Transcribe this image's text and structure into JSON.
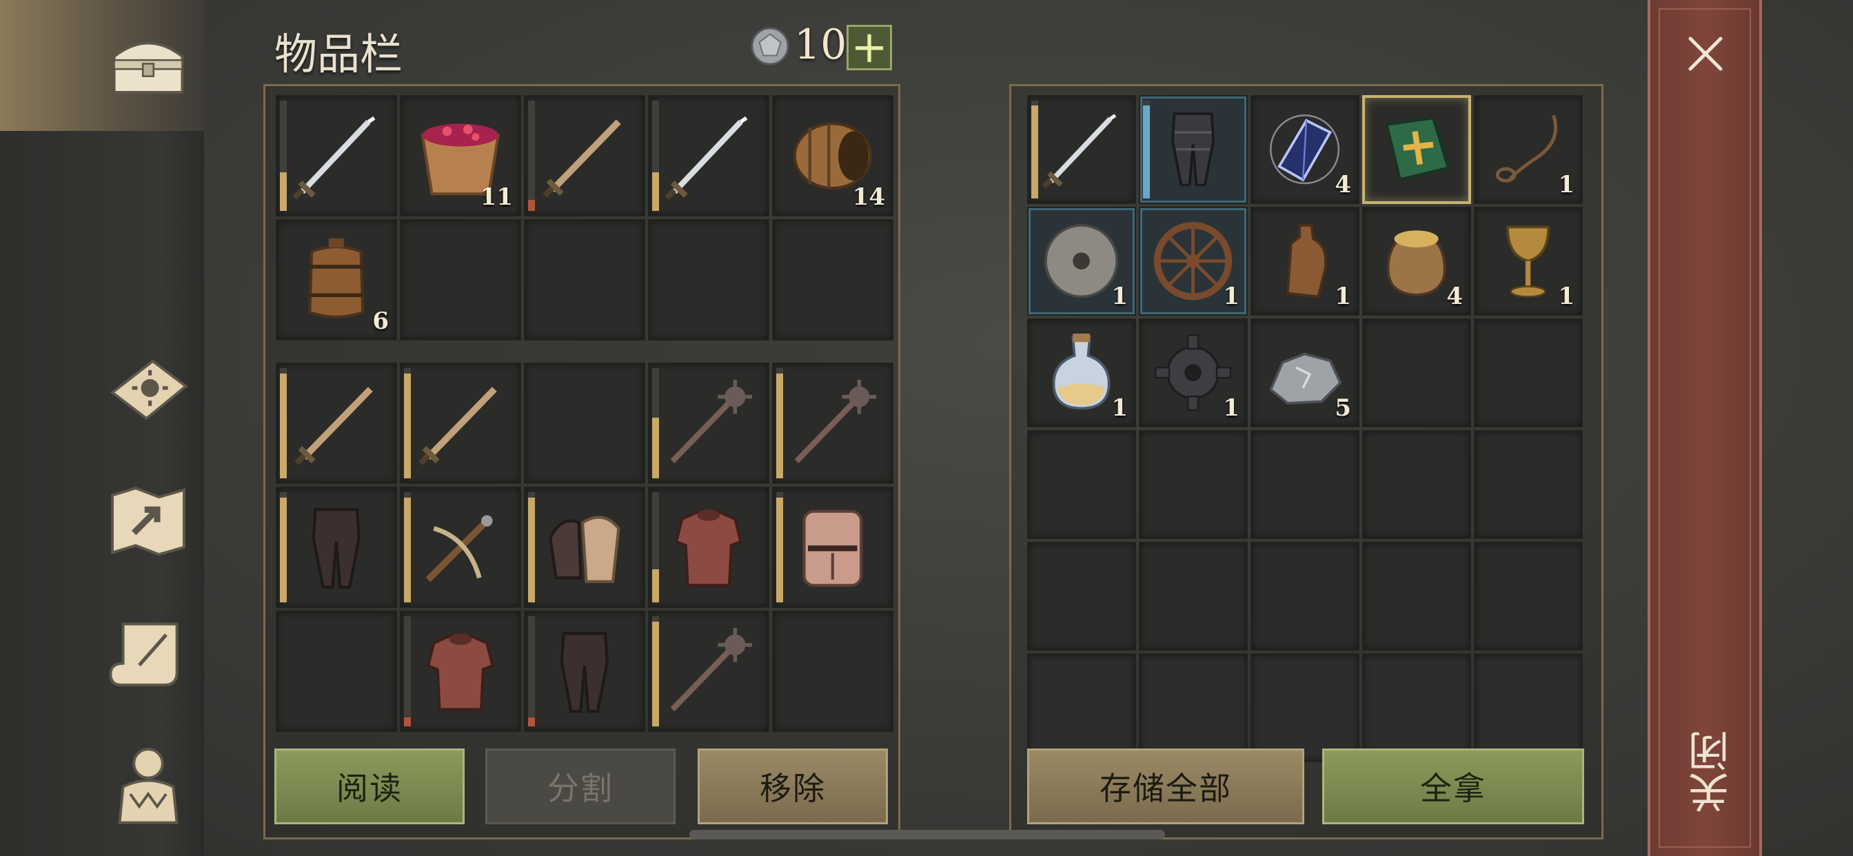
{
  "inventory": {
    "title": "物品栏",
    "currency": "10",
    "plus": "+",
    "top_slots": [
      {
        "icon": "sword-icon",
        "qty": "",
        "durability": 0.35,
        "dur_color": "tan"
      },
      {
        "icon": "berry-bucket-icon",
        "qty": "11"
      },
      {
        "icon": "wooden-sword-icon",
        "qty": "",
        "durability": 0.1,
        "dur_color": "red"
      },
      {
        "icon": "sword-icon",
        "qty": "",
        "durability": 0.35,
        "dur_color": "tan"
      },
      {
        "icon": "barrel-icon",
        "qty": "14"
      },
      {
        "icon": "wine-barrel-icon",
        "qty": "6"
      },
      {
        "icon": "",
        "qty": ""
      },
      {
        "icon": "",
        "qty": ""
      },
      {
        "icon": "",
        "qty": ""
      },
      {
        "icon": "",
        "qty": ""
      }
    ],
    "gear_slots": [
      {
        "icon": "wooden-sword-icon",
        "durability": 0.95,
        "dur_color": "tan"
      },
      {
        "icon": "wooden-sword-icon",
        "durability": 0.95,
        "dur_color": "tan"
      },
      {
        "icon": "",
        "durability": null
      },
      {
        "icon": "mace-icon",
        "durability": 0.55,
        "dur_color": "tan"
      },
      {
        "icon": "mace-icon",
        "durability": 0.95,
        "dur_color": "tan"
      },
      {
        "icon": "leather-pants-icon",
        "durability": 0.95,
        "dur_color": "tan"
      },
      {
        "icon": "crossbow-icon",
        "durability": 0.95,
        "dur_color": "tan"
      },
      {
        "icon": "gauntlets-icon",
        "durability": 0.95,
        "dur_color": "tan"
      },
      {
        "icon": "chainmail-icon",
        "durability": 0.3,
        "dur_color": "tan"
      },
      {
        "icon": "great-helm-icon",
        "durability": 0.95,
        "dur_color": "tan"
      },
      {
        "icon": "",
        "durability": null
      },
      {
        "icon": "chainmail-icon",
        "durability": 0.08,
        "dur_color": "red"
      },
      {
        "icon": "leather-pants-icon",
        "durability": 0.08,
        "dur_color": "red"
      },
      {
        "icon": "mace-icon",
        "durability": 0.95,
        "dur_color": "tan"
      },
      {
        "icon": "",
        "durability": null
      }
    ],
    "buttons": {
      "read": "阅读",
      "split": "分割",
      "remove": "移除"
    }
  },
  "storage": {
    "slots": [
      {
        "icon": "sword-icon",
        "qty": "",
        "durability": 0.95,
        "dur_color": "tan"
      },
      {
        "icon": "iron-greaves-icon",
        "qty": "",
        "durability": 0.95,
        "dur_color": "blue",
        "blue": true
      },
      {
        "icon": "crystal-icon",
        "qty": "4"
      },
      {
        "icon": "green-book-icon",
        "qty": "",
        "selected": true
      },
      {
        "icon": "rope-icon",
        "qty": "1"
      },
      {
        "icon": "millstone-icon",
        "qty": "1",
        "blue": true
      },
      {
        "icon": "wheel-icon",
        "qty": "1",
        "blue": true
      },
      {
        "icon": "leather-bottle-icon",
        "qty": "1"
      },
      {
        "icon": "grain-sack-icon",
        "qty": "4"
      },
      {
        "icon": "goblet-icon",
        "qty": "1"
      },
      {
        "icon": "potion-icon",
        "qty": "1"
      },
      {
        "icon": "gear-icon",
        "qty": "1"
      },
      {
        "icon": "ore-icon",
        "qty": "5"
      },
      {
        "icon": "",
        "qty": ""
      },
      {
        "icon": "",
        "qty": ""
      },
      {
        "icon": "",
        "qty": ""
      },
      {
        "icon": "",
        "qty": ""
      },
      {
        "icon": "",
        "qty": ""
      },
      {
        "icon": "",
        "qty": ""
      },
      {
        "icon": "",
        "qty": ""
      },
      {
        "icon": "",
        "qty": ""
      },
      {
        "icon": "",
        "qty": ""
      },
      {
        "icon": "",
        "qty": ""
      },
      {
        "icon": "",
        "qty": ""
      },
      {
        "icon": "",
        "qty": ""
      },
      {
        "icon": "",
        "qty": "",
        "faded": true
      },
      {
        "icon": "",
        "qty": "",
        "faded": true
      },
      {
        "icon": "",
        "qty": "",
        "faded": true
      },
      {
        "icon": "",
        "qty": "",
        "faded": true
      },
      {
        "icon": "",
        "qty": "",
        "faded": true
      }
    ],
    "buttons": {
      "store_all": "存储全部",
      "take_all": "全拿"
    }
  },
  "close": {
    "label": "关闭"
  },
  "sidebar": [
    "chest-icon",
    "sun-book-icon",
    "map-icon",
    "scroll-icon",
    "character-icon"
  ],
  "colors": {
    "accent_green": "#8c9a5c",
    "accent_tan": "#9a8a66",
    "close_red": "#80453a"
  }
}
